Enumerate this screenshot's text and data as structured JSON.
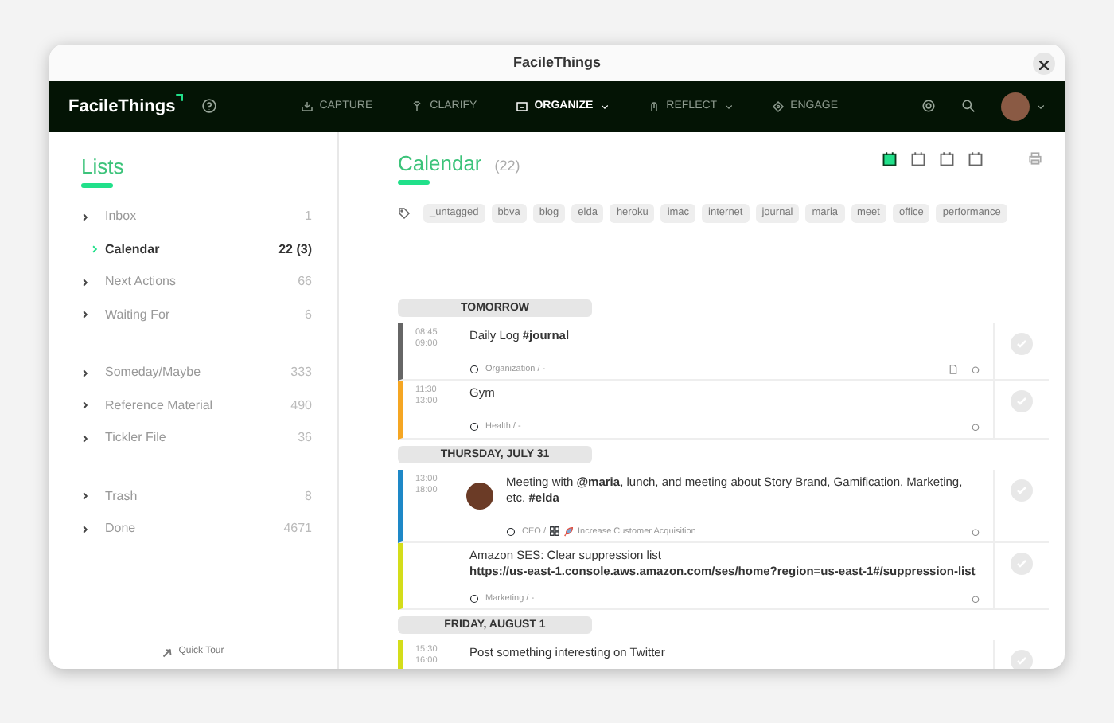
{
  "window": {
    "title": "FacileThings"
  },
  "navbar": {
    "logo": "FacileThings",
    "items": [
      {
        "label": "CAPTURE",
        "selected": false,
        "dropdown": false
      },
      {
        "label": "CLARIFY",
        "selected": false,
        "dropdown": false
      },
      {
        "label": "ORGANIZE",
        "selected": true,
        "dropdown": true
      },
      {
        "label": "REFLECT",
        "selected": false,
        "dropdown": true
      },
      {
        "label": "ENGAGE",
        "selected": false,
        "dropdown": false
      }
    ]
  },
  "sidebar": {
    "title": "Lists",
    "groups": [
      [
        {
          "label": "Inbox",
          "count": "1",
          "selected": false
        },
        {
          "label": "Calendar",
          "count": "22 (3)",
          "selected": true
        },
        {
          "label": "Next Actions",
          "count": "66",
          "selected": false
        },
        {
          "label": "Waiting For",
          "count": "6",
          "selected": false
        }
      ],
      [
        {
          "label": "Someday/Maybe",
          "count": "333",
          "selected": false
        },
        {
          "label": "Reference Material",
          "count": "490",
          "selected": false
        },
        {
          "label": "Tickler File",
          "count": "36",
          "selected": false
        }
      ],
      [
        {
          "label": "Trash",
          "count": "8",
          "selected": false
        },
        {
          "label": "Done",
          "count": "4671",
          "selected": false
        }
      ]
    ],
    "footer": "Quick Tour"
  },
  "main": {
    "title": "Calendar",
    "count": "(22)",
    "views": [
      {
        "selected": true
      },
      {
        "selected": false
      },
      {
        "selected": false
      },
      {
        "selected": false
      }
    ],
    "tags": [
      "_untagged",
      "bbva",
      "blog",
      "elda",
      "heroku",
      "imac",
      "internet",
      "journal",
      "maria",
      "meet",
      "office",
      "performance"
    ],
    "days": [
      {
        "label": "TOMORROW",
        "events": [
          {
            "start": "08:45",
            "end": "09:00",
            "title": "Daily Log **#journal**",
            "color": "#666666",
            "avatar": false,
            "area": "Organization / -",
            "note": true
          },
          {
            "start": "11:30",
            "end": "13:00",
            "title": "Gym",
            "color": "#f5a623",
            "avatar": false,
            "area": "Health / -",
            "note": false
          }
        ]
      },
      {
        "label": "THURSDAY, JULY 31",
        "events": [
          {
            "start": "13:00",
            "end": "18:00",
            "title": "Meeting with **@maria**, lunch, and meeting about Story Brand, Gamification, Marketing, etc. **#elda**",
            "color": "#1e88c7",
            "avatar": true,
            "area": "CEO /",
            "project": "Increase Customer Acquisition",
            "note": false
          },
          {
            "title": "Amazon SES: Clear suppression list",
            "link": "https://us-east-1.console.aws.amazon.com/ses/home?region=us-east-1#/suppression-list",
            "color": "#d4dd1a",
            "avatar": false,
            "area": "Marketing / -",
            "note": false
          }
        ]
      },
      {
        "label": "FRIDAY, AUGUST 1",
        "events": [
          {
            "start": "15:30",
            "end": "16:00",
            "title": "Post something interesting on Twitter",
            "color": "#d4dd1a",
            "avatar": false,
            "note": false
          }
        ]
      }
    ]
  }
}
